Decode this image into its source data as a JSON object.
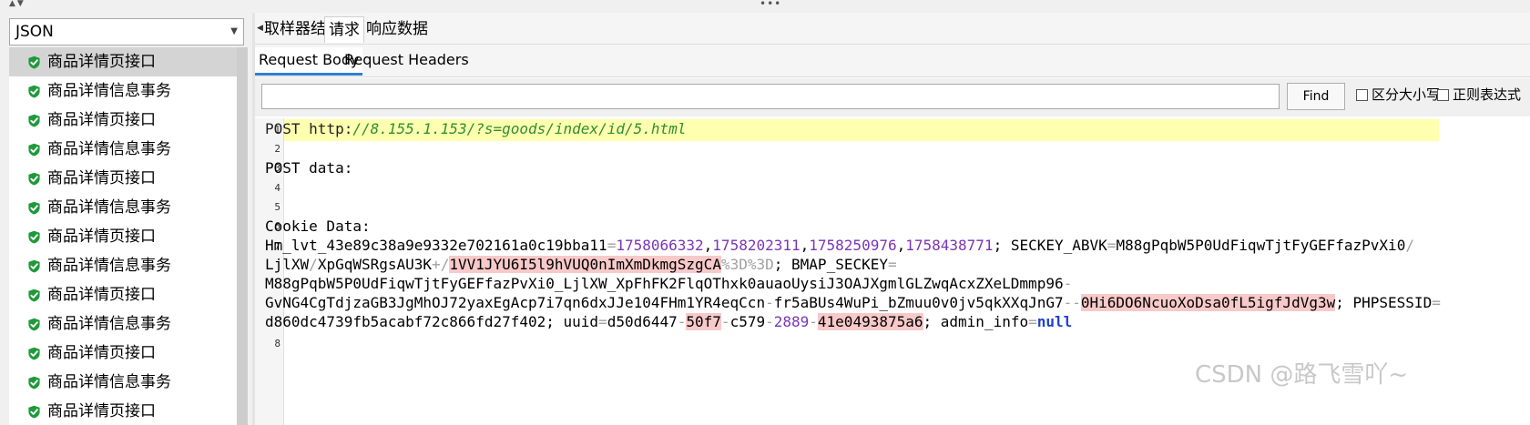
{
  "left": {
    "renderer_select": "JSON",
    "results": [
      {
        "label": "商品详情页接口",
        "selected": true
      },
      {
        "label": "商品详情信息事务"
      },
      {
        "label": "商品详情页接口"
      },
      {
        "label": "商品详情信息事务"
      },
      {
        "label": "商品详情页接口"
      },
      {
        "label": "商品详情信息事务"
      },
      {
        "label": "商品详情页接口"
      },
      {
        "label": "商品详情信息事务"
      },
      {
        "label": "商品详情页接口"
      },
      {
        "label": "商品详情信息事务"
      },
      {
        "label": "商品详情页接口"
      },
      {
        "label": "商品详情信息事务"
      },
      {
        "label": "商品详情页接口"
      }
    ],
    "status_icon": "green-shield-check-icon"
  },
  "tabs": {
    "sampler_result": "取样器结果",
    "request": "请求",
    "response_data": "响应数据"
  },
  "subtabs": {
    "request_body": "Request Body",
    "request_headers": "Request Headers"
  },
  "search": {
    "value": "",
    "find_label": "Find",
    "case_sensitive": "区分大小写",
    "regex": "正则表达式"
  },
  "editor": {
    "line_numbers": [
      "1",
      "2",
      "3",
      "4",
      "5",
      "6",
      "7",
      "8"
    ],
    "line1_method": "POST ",
    "line1_scheme": "http:",
    "line1_url": "//8.155.1.153/?s=goods/index/id/5.html",
    "line3": "POST data:",
    "line6": "Cookie Data:",
    "c1_a": "Hm_lvt_43e89c38a9e9332e702161a0c19bba11",
    "c1_eq": "=",
    "c1_n1": "1758066332",
    "c1_n2": "1758202311",
    "c1_n3": "1758250976",
    "c1_n4": "1758438771",
    "comma": ",",
    "c1_b": "; SECKEY_ABVK",
    "c1_c": "M88gPqbW5P0UdFiqwTjtFyGEFfazPvXi0",
    "slash": "/",
    "c2_a": "LjlXW",
    "c2_b": "XpGqWSRgsAU3K",
    "plus": "+",
    "c2_c": "1VV1JYU6I5l9hVUQ0nImXmDkmgSzgCA",
    "pct": "%3D",
    "c2_d": "; BMAP_SECKEY",
    "c3": "M88gPqbW5P0UdFiqwTjtFyGEFfazPvXi0_LjlXW_XpFhFK2FlqOThxk0auaoUysiJ3OAJXgmlGLZwqAcxZXeLDmmp96",
    "dash": "-",
    "c4_a": "GvNG4CgTdjzaGB3JgMhOJ72yaxEgAcp7i7qn6dxJJe104FHm1YR4eqCcn",
    "c4_b": "fr5aBUs4WuPi_bZmuu0v0jv5qkXXqJnG7",
    "dashdash": "--",
    "c4_c": "0Hi6DO6NcuoXoDsa0fL5igfJdVg3w",
    "c4_d": "; PHPSESSID",
    "c5_a": "d860dc4739fb5acabf72c866fd27f402",
    "c5_b": "; uuid",
    "c5_c": "d50d6447",
    "c5_d": "50f7",
    "c5_e": "c579",
    "c5_f": "2889",
    "c5_g": "41e0493875a6",
    "c5_h": "; admin_info",
    "c5_null": "null"
  },
  "watermark": "CSDN @路飞雪吖~"
}
